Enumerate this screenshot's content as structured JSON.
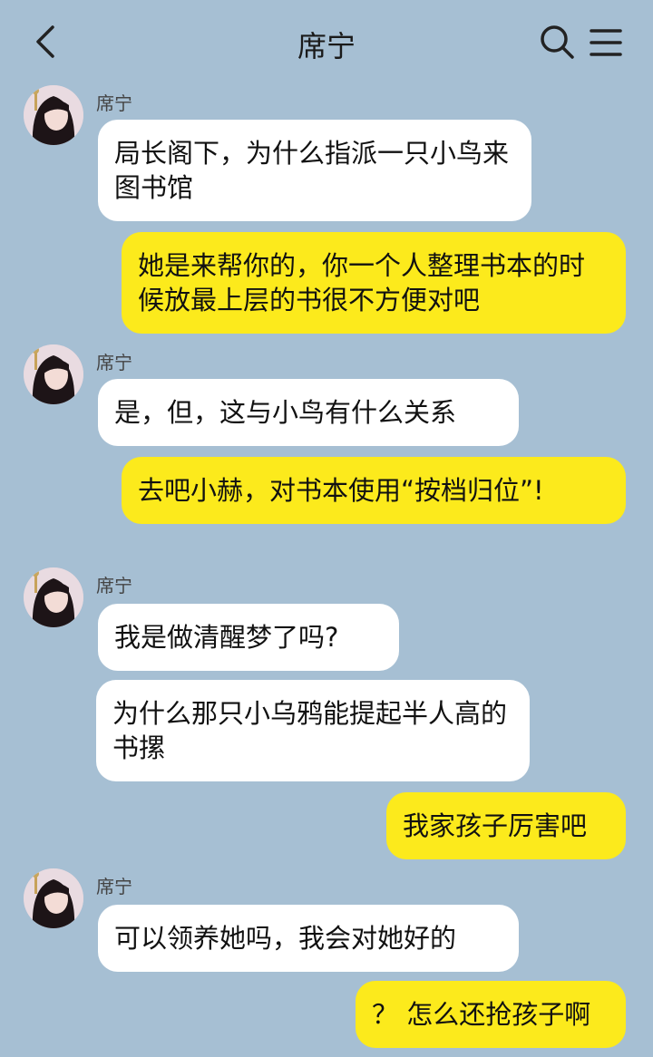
{
  "header": {
    "back_label": "",
    "title": "席宁"
  },
  "messages": [
    {
      "from": "them",
      "sender": "席宁",
      "text": "局长阁下，为什么指派一只小鸟来图书馆"
    },
    {
      "from": "me",
      "text": "她是来帮你的，你一个人整理书本的时候放最上层的书很不方便对吧"
    },
    {
      "from": "them",
      "sender": "席宁",
      "text": "是，但，这与小鸟有什么关系"
    },
    {
      "from": "me",
      "text": "去吧小赫，对书本使用“按档归位”!"
    },
    {
      "from": "them",
      "sender": "席宁",
      "text": "我是做清醒梦了吗?"
    },
    {
      "from": "them",
      "text": "为什么那只小乌鸦能提起半人高的书摞"
    },
    {
      "from": "me",
      "text": "我家孩子厉害吧"
    },
    {
      "from": "them",
      "sender": "席宁",
      "text": "可以领养她吗，我会对她好的"
    },
    {
      "from": "me",
      "text": "？ 怎么还抢孩子啊"
    }
  ],
  "colors": {
    "background": "#a6bfd3",
    "incoming_bubble": "#ffffff",
    "outgoing_bubble": "#fcea1c"
  }
}
